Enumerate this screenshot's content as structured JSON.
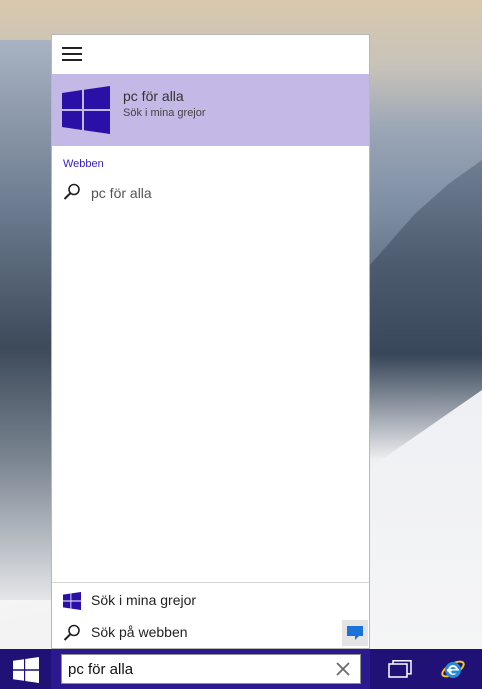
{
  "panel": {
    "best_match": {
      "title": "pc för alla",
      "subtitle": "Sök i mina grejor",
      "icon": "windows-logo-icon"
    },
    "web_section_label": "Webben",
    "web_result": {
      "text": "pc för alla",
      "icon": "search-icon"
    },
    "bottom_items": [
      {
        "label": "Sök i mina grejor",
        "icon": "windows-logo-icon"
      },
      {
        "label": "Sök på webben",
        "icon": "search-icon"
      }
    ]
  },
  "taskbar": {
    "search_value": "pc för alla",
    "icons": [
      "windows-start-icon",
      "task-view-icon",
      "internet-explorer-icon"
    ]
  },
  "colors": {
    "accent": "#1f1175",
    "highlight": "#c3b8e6",
    "section_label": "#3a1fb8"
  }
}
